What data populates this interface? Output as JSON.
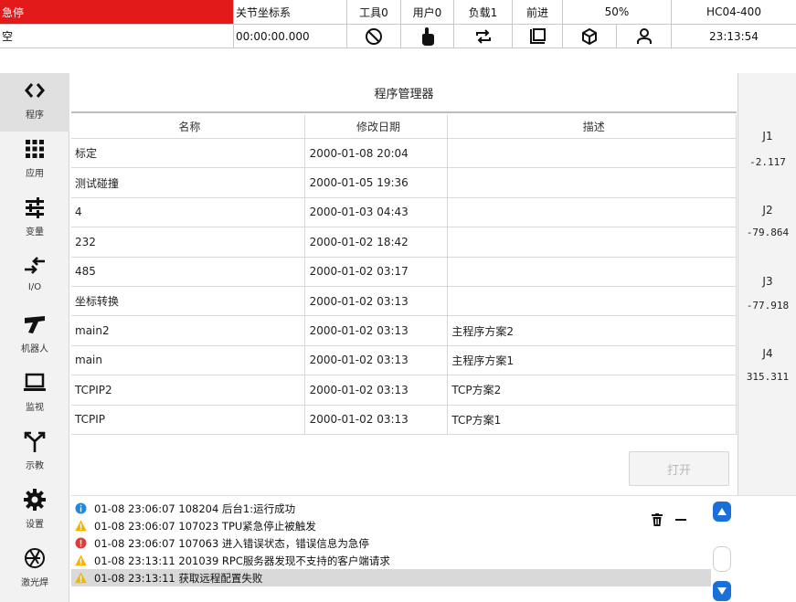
{
  "status": {
    "row1": {
      "estop": "急停",
      "coord": "关节坐标系",
      "tool": "工具0",
      "user": "用户0",
      "load": "负载1",
      "direction": "前进",
      "speed": "50%",
      "model": "HC04-400"
    },
    "row2": {
      "program_state": "空",
      "run_time": "00:00:00.000",
      "icons": [
        "no-entry-icon",
        "pointer-hand-icon",
        "loop-icon",
        "copy-square-icon",
        "cube-icon",
        "user-icon"
      ],
      "clock": "23:13:54"
    },
    "estop_color": "#e21a1a"
  },
  "nav": {
    "items": [
      {
        "label": "程序",
        "icon": "code-brackets-icon",
        "active": true
      },
      {
        "label": "应用",
        "icon": "apps-grid-icon",
        "active": false
      },
      {
        "label": "变量",
        "icon": "sliders-icon",
        "active": false
      },
      {
        "label": "I/O",
        "icon": "io-arrows-icon",
        "active": false
      },
      {
        "label": "机器人",
        "icon": "robot-arm-icon",
        "active": false
      },
      {
        "label": "监视",
        "icon": "laptop-icon",
        "active": false
      },
      {
        "label": "示教",
        "icon": "teach-fork-icon",
        "active": false
      },
      {
        "label": "设置",
        "icon": "gear-icon",
        "active": false
      },
      {
        "label": "激光焊",
        "icon": "aperture-icon",
        "active": false
      }
    ]
  },
  "program_manager": {
    "title": "程序管理器",
    "columns": [
      "名称",
      "修改日期",
      "描述"
    ],
    "rows": [
      {
        "name": "标定",
        "date": "2000-01-08 20:04",
        "desc": ""
      },
      {
        "name": "测试碰撞",
        "date": "2000-01-05 19:36",
        "desc": ""
      },
      {
        "name": "4",
        "date": "2000-01-03 04:43",
        "desc": ""
      },
      {
        "name": "232",
        "date": "2000-01-02 18:42",
        "desc": ""
      },
      {
        "name": "485",
        "date": "2000-01-02 03:17",
        "desc": ""
      },
      {
        "name": "坐标转换",
        "date": "2000-01-02 03:13",
        "desc": ""
      },
      {
        "name": "main2",
        "date": "2000-01-02 03:13",
        "desc": "主程序方案2"
      },
      {
        "name": "main",
        "date": "2000-01-02 03:13",
        "desc": "主程序方案1"
      },
      {
        "name": "TCPIP2",
        "date": "2000-01-02 03:13",
        "desc": "TCP方案2"
      },
      {
        "name": "TCPIP",
        "date": "2000-01-02 03:13",
        "desc": "TCP方案1"
      }
    ],
    "open_label": "打开"
  },
  "joints": [
    {
      "name": "J1",
      "value": "-2.117"
    },
    {
      "name": "J2",
      "value": "-79.864"
    },
    {
      "name": "J3",
      "value": "-77.918"
    },
    {
      "name": "J4",
      "value": "315.311"
    }
  ],
  "log": {
    "entries": [
      {
        "level": "info",
        "text": "01-08 23:06:07 108204 后台1:运行成功"
      },
      {
        "level": "warning",
        "text": "01-08 23:06:07 107023 TPU紧急停止被触发"
      },
      {
        "level": "error",
        "text": "01-08 23:06:07 107063 进入错误状态，错误信息为急停"
      },
      {
        "level": "warning",
        "text": "01-08 23:13:11 201039 RPC服务器发现不支持的客户端请求"
      },
      {
        "level": "warning",
        "text": "01-08 23:13:11 获取远程配置失败"
      }
    ],
    "colors": {
      "info": "#1e88e5",
      "warning": "#f5b400",
      "error": "#e53935",
      "scroll": "#1a6fd8"
    }
  }
}
